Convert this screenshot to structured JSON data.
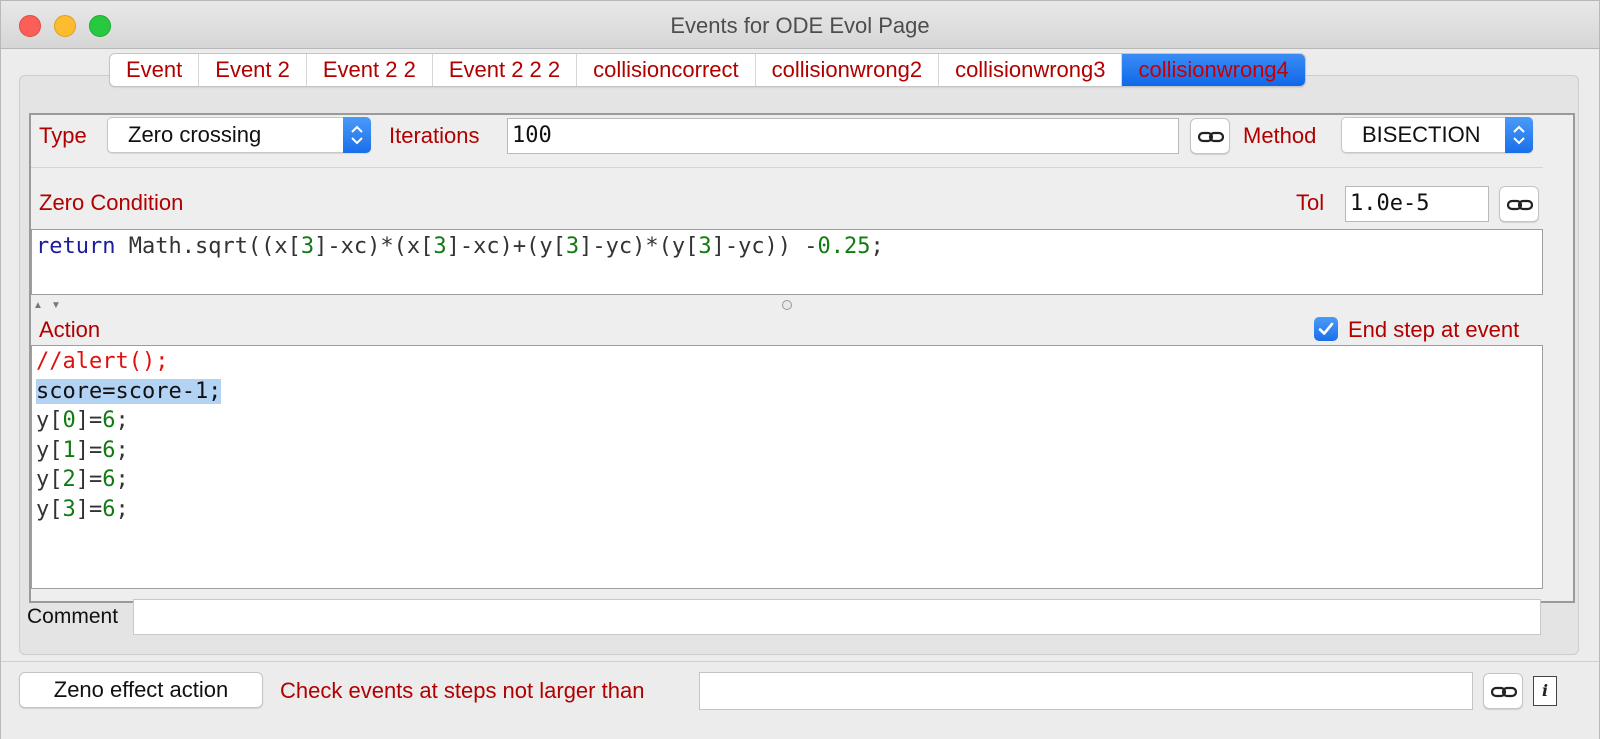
{
  "window": {
    "title": "Events for ODE Evol Page"
  },
  "tabs": [
    {
      "label": "Event",
      "active": false
    },
    {
      "label": "Event 2",
      "active": false
    },
    {
      "label": "Event 2 2",
      "active": false
    },
    {
      "label": "Event 2 2 2",
      "active": false
    },
    {
      "label": "collisioncorrect",
      "active": false
    },
    {
      "label": "collisionwrong2",
      "active": false
    },
    {
      "label": "collisionwrong3",
      "active": false
    },
    {
      "label": "collisionwrong4",
      "active": true
    }
  ],
  "event": {
    "type_label": "Type",
    "type_value": "Zero crossing",
    "iterations_label": "Iterations",
    "iterations_value": "100",
    "method_label": "Method",
    "method_value": "BISECTION",
    "zero_condition_label": "Zero Condition",
    "tol_label": "Tol",
    "tol_value": "1.0e-5",
    "zero_condition_code": {
      "keyword": "return",
      "tokens": [
        {
          "t": " Math.sqrt((x[",
          "c": "plain"
        },
        {
          "t": "3",
          "c": "num"
        },
        {
          "t": "]-xc)*(x[",
          "c": "plain"
        },
        {
          "t": "3",
          "c": "num"
        },
        {
          "t": "]-xc)+(y[",
          "c": "plain"
        },
        {
          "t": "3",
          "c": "num"
        },
        {
          "t": "]-yc)*(y[",
          "c": "plain"
        },
        {
          "t": "3",
          "c": "num"
        },
        {
          "t": "]-yc)) -",
          "c": "plain"
        },
        {
          "t": "0.25",
          "c": "num"
        },
        {
          "t": ";",
          "c": "plain"
        }
      ]
    },
    "action_label": "Action",
    "end_step_label": "End step at event",
    "end_step_checked": true,
    "action_code": {
      "comment_line": "//alert();",
      "selected_line": "score=score-1;",
      "assignments": [
        {
          "pre": "y[",
          "idx": "0",
          "mid": "]=",
          "val": "6",
          "post": ";"
        },
        {
          "pre": "y[",
          "idx": "1",
          "mid": "]=",
          "val": "6",
          "post": ";"
        },
        {
          "pre": "y[",
          "idx": "2",
          "mid": "]=",
          "val": "6",
          "post": ";"
        },
        {
          "pre": "y[",
          "idx": "3",
          "mid": "]=",
          "val": "6",
          "post": ";"
        }
      ]
    },
    "comment_label": "Comment",
    "comment_value": ""
  },
  "bottom": {
    "zeno_button_label": "Zeno effect action",
    "check_steps_label": "Check events at steps not larger than",
    "check_steps_value": "",
    "info_icon_text": "i"
  },
  "icons": {
    "link": "link-icon",
    "info": "info-document-icon",
    "updown": "up-down-chevron-icon"
  },
  "colors": {
    "label_red": "#b00000",
    "keyword_blue": "#1b1b9c",
    "number_green": "#117a11",
    "comment_red": "#e01010",
    "selection_blue": "#b3d3f5",
    "accent_blue": "#1a6fe9"
  }
}
